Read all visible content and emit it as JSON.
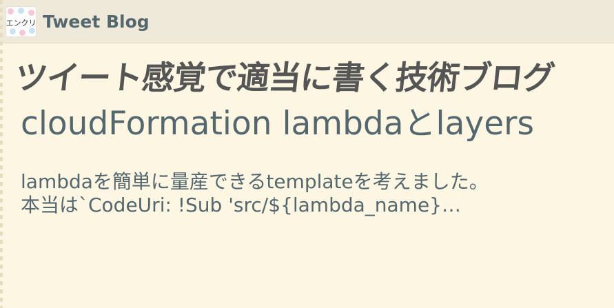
{
  "header": {
    "logo_text": "エンクリ",
    "site_title": "Tweet Blog"
  },
  "tagline": "ツイート感覚で適当に書く技術ブログ",
  "post": {
    "title": "cloudFormation lambdaとlayers",
    "excerpt": "lambdaを簡単に量産できるtemplateを考えました。",
    "snippet": "本当は`CodeUri: !Sub 'src/${lambda_name}…"
  },
  "colors": {
    "background": "#fdf6e3",
    "header_background": "#efe9d9",
    "title_text": "#54676e",
    "tagline_text": "#555555"
  }
}
